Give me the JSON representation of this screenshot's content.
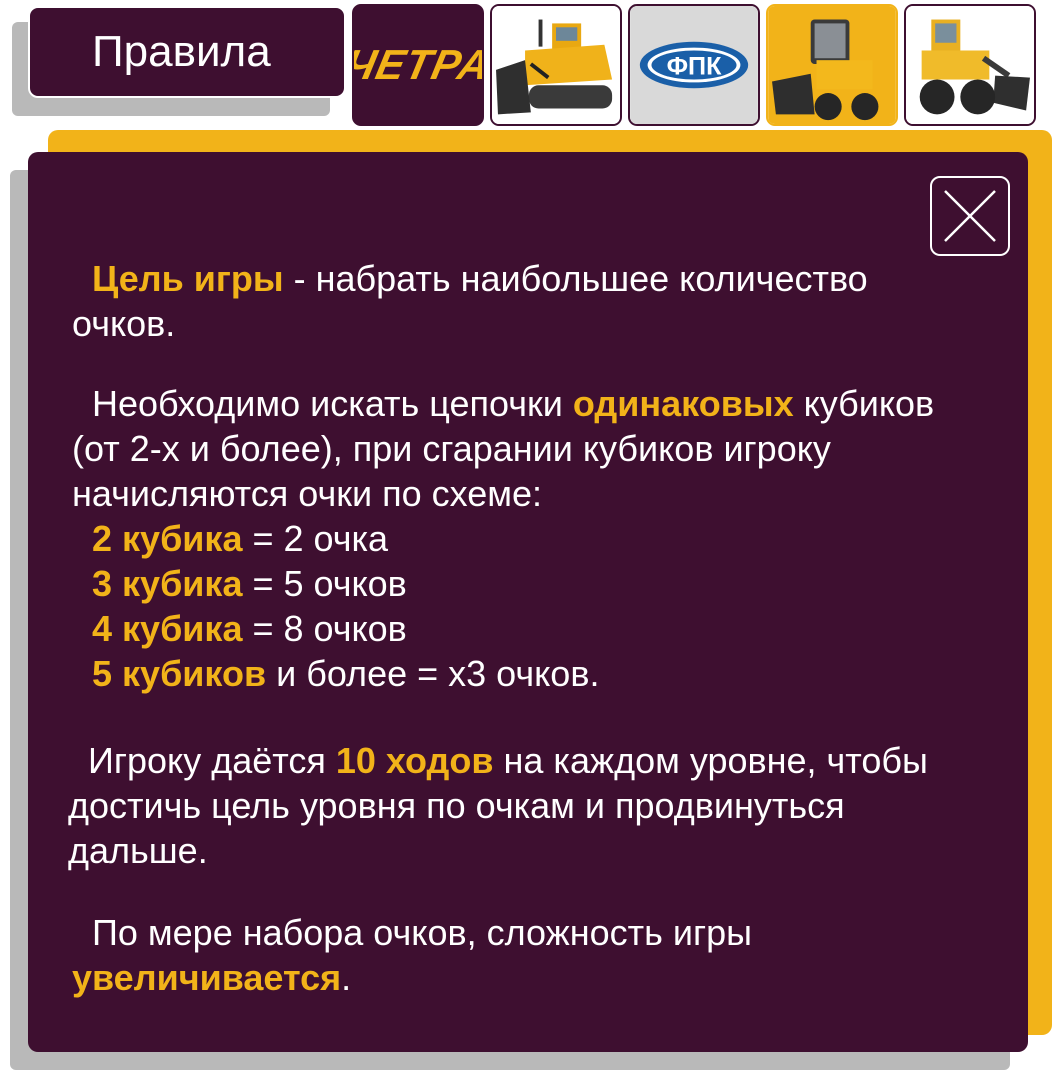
{
  "tabs": {
    "title": "Правила",
    "chetra_logo_text": "ЧЕТРА",
    "fpk_logo_text": "ФПК",
    "thumbnails": [
      "chetra-logo",
      "bulldozer-image",
      "fpk-logo",
      "skid-steer-loader-image",
      "wheel-loader-image"
    ]
  },
  "rules": {
    "p1": {
      "hl": "Цель игры",
      "text": " - набрать наибольшее количество",
      "line2": "очков."
    },
    "p2": {
      "pre": "Необходимо искать цепочки ",
      "hl": "одинаковых",
      "post": " кубиков",
      "line2": "(от 2-х и более), при сгарании кубиков игроку",
      "line3": "начисляются очки по схеме:"
    },
    "scores": [
      {
        "hl": "2 кубика",
        "text": " = 2 очка"
      },
      {
        "hl": "3 кубика",
        "text": " = 5 очков"
      },
      {
        "hl": "4 кубика",
        "text": " = 8 очков"
      },
      {
        "hl": "5 кубиков",
        "text": " и более = x3 очков."
      }
    ],
    "p3": {
      "pre": "Игроку даётся ",
      "hl": "10 ходов",
      "post": " на каждом уровне, чтобы",
      "line2": "достичь цель уровня по очкам и продвинуться",
      "line3": "дальше."
    },
    "p4": {
      "text": "По мере набора очков, сложность игры",
      "hl": "увеличивается",
      "post": "."
    }
  },
  "colors": {
    "panel": "#3e0f30",
    "accent": "#f2b319",
    "text": "#ffffff"
  },
  "icons": {
    "close": "close-icon"
  }
}
